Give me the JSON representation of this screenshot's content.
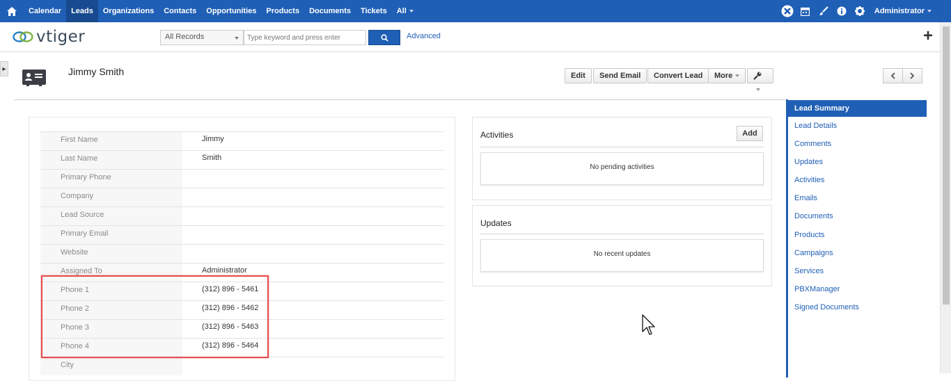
{
  "nav": {
    "items": [
      "Calendar",
      "Leads",
      "Organizations",
      "Contacts",
      "Opportunities",
      "Products",
      "Documents",
      "Tickets",
      "All"
    ],
    "active": "Leads",
    "user": "Administrator"
  },
  "brand": {
    "logo_text": "vtiger"
  },
  "search": {
    "scope": "All Records",
    "placeholder": "Type keyword and press enter",
    "advanced_label": "Advanced"
  },
  "record": {
    "title": "Jimmy Smith",
    "actions": {
      "edit": "Edit",
      "send_email": "Send Email",
      "convert_lead": "Convert Lead",
      "more": "More"
    }
  },
  "fields": [
    {
      "label": "First Name",
      "value": "Jimmy"
    },
    {
      "label": "Last Name",
      "value": "Smith"
    },
    {
      "label": "Primary Phone",
      "value": ""
    },
    {
      "label": "Company",
      "value": ""
    },
    {
      "label": "Lead Source",
      "value": ""
    },
    {
      "label": "Primary Email",
      "value": ""
    },
    {
      "label": "Website",
      "value": ""
    },
    {
      "label": "Assigned To",
      "value": "Administrator"
    },
    {
      "label": "Phone 1",
      "value": "(312) 896 - 5461"
    },
    {
      "label": "Phone 2",
      "value": "(312) 896 - 5462"
    },
    {
      "label": "Phone 3",
      "value": "(312) 896 - 5463"
    },
    {
      "label": "Phone 4",
      "value": "(312) 896 - 5464"
    },
    {
      "label": "City",
      "value": ""
    }
  ],
  "activities": {
    "title": "Activities",
    "add_label": "Add",
    "empty": "No pending activities"
  },
  "updates": {
    "title": "Updates",
    "empty": "No recent updates"
  },
  "sidebar": {
    "items": [
      "Lead Summary",
      "Lead Details",
      "Comments",
      "Updates",
      "Activities",
      "Emails",
      "Documents",
      "Products",
      "Campaigns",
      "Services",
      "PBXManager",
      "Signed Documents"
    ],
    "active": "Lead Summary"
  },
  "colors": {
    "accent": "#1f5fb5",
    "highlight": "#e74b4b"
  }
}
